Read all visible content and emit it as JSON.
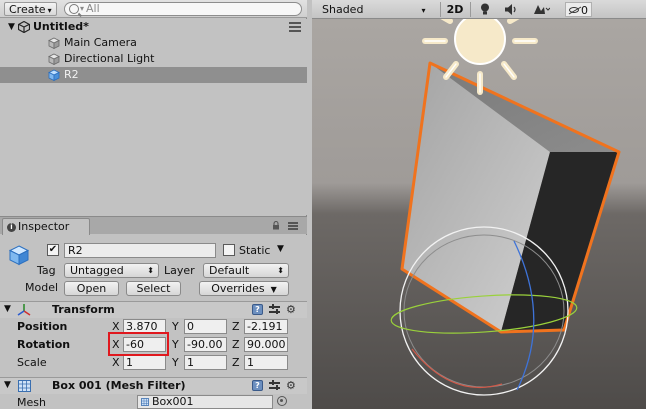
{
  "hierarchy": {
    "create_label": "Create",
    "search_placeholder": "All",
    "scene_name": "Untitled*",
    "items": [
      {
        "label": "Main Camera"
      },
      {
        "label": "Directional Light"
      },
      {
        "label": "R2"
      }
    ]
  },
  "inspector": {
    "tab_label": "Inspector",
    "object_name": "R2",
    "active": true,
    "static_label": "Static",
    "static_checked": false,
    "tag_label": "Tag",
    "tag_value": "Untagged",
    "layer_label": "Layer",
    "layer_value": "Default",
    "model_label": "Model",
    "open_label": "Open",
    "select_label": "Select",
    "overrides_label": "Overrides"
  },
  "transform": {
    "title": "Transform",
    "position": {
      "label": "Position",
      "x": "3.870",
      "y": "0",
      "z": "-2.191"
    },
    "rotation": {
      "label": "Rotation",
      "x": "-60",
      "y": "-90.00",
      "z": "90.000"
    },
    "scale": {
      "label": "Scale",
      "x": "1",
      "y": "1",
      "z": "1"
    },
    "axis_x": "X",
    "axis_y": "Y",
    "axis_z": "Z"
  },
  "mesh_filter": {
    "title": "Box 001 (Mesh Filter)",
    "mesh_label": "Mesh",
    "mesh_value": "Box001"
  },
  "scene_toolbar": {
    "shading_mode": "Shaded",
    "mode_2d": "2D",
    "gizmo_count": "0"
  },
  "colors": {
    "selection_outline": "#f0731e",
    "highlight_box": "#e0181e",
    "selected_row": "#8f8f8f"
  }
}
